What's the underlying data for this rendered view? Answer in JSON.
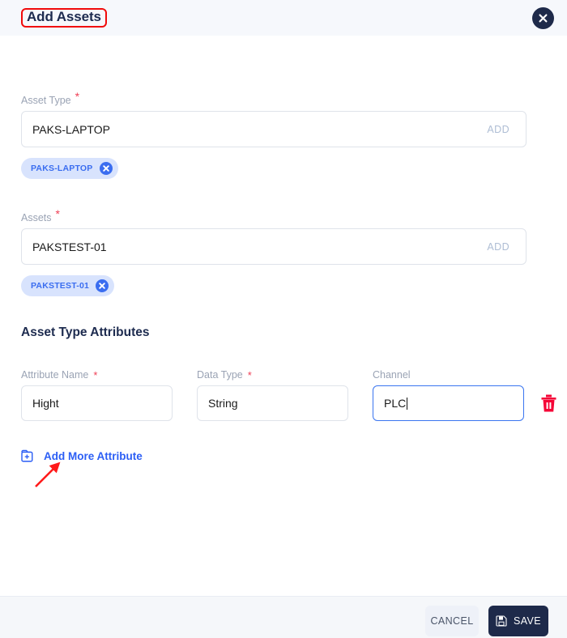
{
  "header": {
    "title": "Add Assets",
    "close_icon": "close-x-icon",
    "annotation_color": "#f10b0b",
    "title_color": "#1d2b4f",
    "background": "#f6f8fc"
  },
  "form": {
    "asset_type": {
      "label": "Asset Type",
      "required_marker": "*",
      "value": "PAKS-LAPTOP",
      "add_label": "ADD",
      "chips": [
        {
          "label": "PAKS-LAPTOP",
          "remove_icon": "chip-remove-icon"
        }
      ]
    },
    "assets": {
      "label": "Assets",
      "required_marker": "*",
      "value": "PAKSTEST-01",
      "add_label": "ADD",
      "chips": [
        {
          "label": "PAKSTEST-01",
          "remove_icon": "chip-remove-icon"
        }
      ]
    }
  },
  "attributes_section": {
    "heading": "Asset Type Attributes",
    "columns": [
      {
        "label": "Attribute Name",
        "required_marker": "*"
      },
      {
        "label": "Data Type",
        "required_marker": "*"
      },
      {
        "label": "Channel",
        "required_marker": ""
      }
    ],
    "rows": [
      {
        "attribute_name": "Hight",
        "data_type": "String",
        "channel": "PLC",
        "channel_focused": true,
        "delete_icon": "trash-icon"
      }
    ],
    "add_more": {
      "label": "Add More Attribute",
      "icon": "folder-plus-icon",
      "color": "#2b5ef5"
    }
  },
  "footer": {
    "cancel_label": "CANCEL",
    "save_label": "SAVE",
    "save_icon": "save-disk-icon",
    "save_bg": "#1e2a4a",
    "cancel_bg": "#eef1f8"
  },
  "colors": {
    "accent_blue": "#3a6df0",
    "chip_bg": "#d8e3fd",
    "required_red": "#ef4056",
    "annotation_red": "#f10b0b",
    "trash_red": "#f50537",
    "label_gray": "#9aa3b4",
    "border_gray": "#dfe3ea",
    "focus_blue": "#3a75f0"
  }
}
